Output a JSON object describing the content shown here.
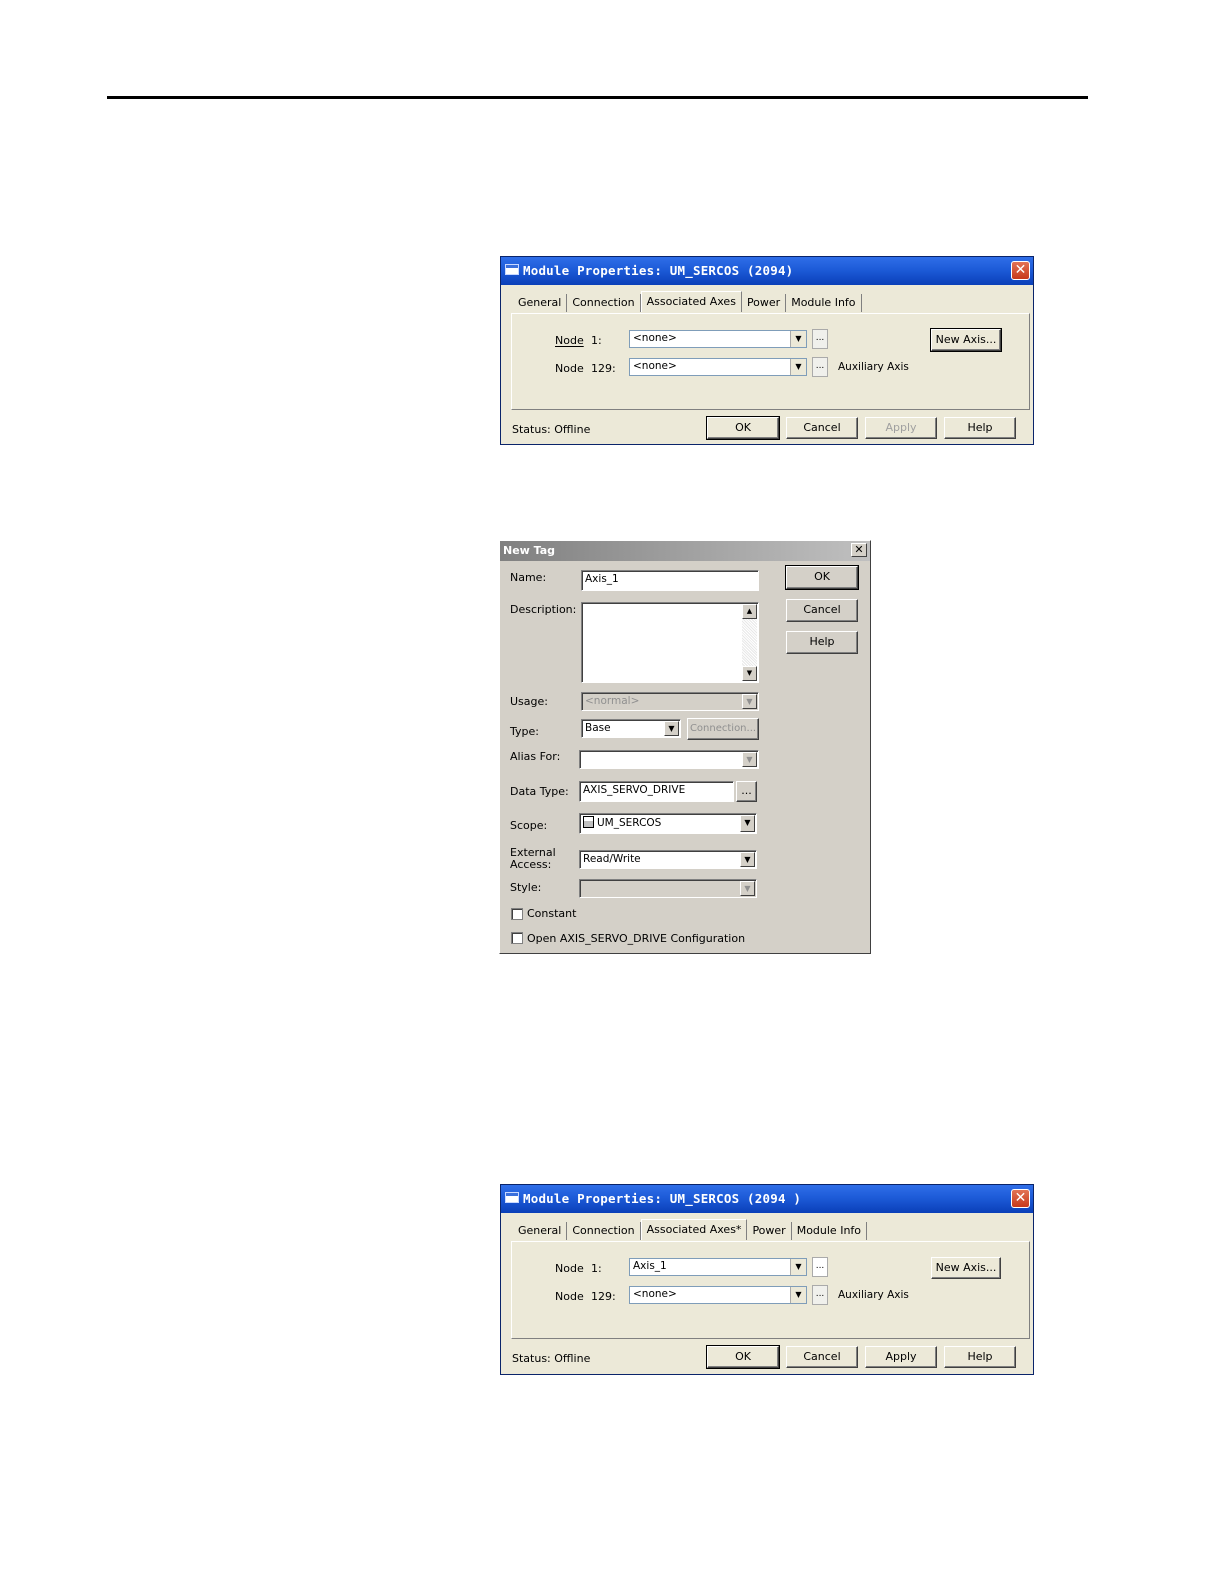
{
  "module_dialog_1": {
    "title": "Module Properties: UM_SERCOS (2094)",
    "tabs": [
      "General",
      "Connection",
      "Associated Axes",
      "Power",
      "Module Info"
    ],
    "node1_label": "Node",
    "node1_num": "1:",
    "node1_value": "<none>",
    "node129_label": "Node",
    "node129_num": "129:",
    "node129_value": "<none>",
    "auxiliary_label": "Auxiliary Axis",
    "new_axis_button": "New Axis...",
    "status": "Status:  Offline",
    "buttons": {
      "ok": "OK",
      "cancel": "Cancel",
      "apply": "Apply",
      "help": "Help"
    },
    "apply_enabled": false
  },
  "new_tag_dialog": {
    "title": "New Tag",
    "name_label": "Name:",
    "name_value": "Axis_1",
    "description_label": "Description:",
    "usage_label": "Usage:",
    "usage_value": "<normal>",
    "type_label": "Type:",
    "type_value": "Base",
    "connection_button": "Connection...",
    "alias_label": "Alias For:",
    "data_type_label": "Data Type:",
    "data_type_value": "AXIS_SERVO_DRIVE",
    "scope_label": "Scope:",
    "scope_value": "UM_SERCOS",
    "external_access_label_1": "External",
    "external_access_label_2": "Access:",
    "external_access_value": "Read/Write",
    "style_label": "Style:",
    "constant_label": "Constant",
    "open_config_label": "Open AXIS_SERVO_DRIVE Configuration",
    "buttons": {
      "ok": "OK",
      "cancel": "Cancel",
      "help": "Help"
    }
  },
  "module_dialog_2": {
    "title": "Module Properties: UM_SERCOS (2094 )",
    "tabs": [
      "General",
      "Connection",
      "Associated Axes*",
      "Power",
      "Module Info"
    ],
    "node1_label": "Node",
    "node1_num": "1:",
    "node1_value": "Axis_1",
    "node129_label": "Node",
    "node129_num": "129:",
    "node129_value": "<none>",
    "auxiliary_label": "Auxiliary Axis",
    "new_axis_button": "New Axis...",
    "status": "Status:  Offline",
    "buttons": {
      "ok": "OK",
      "cancel": "Cancel",
      "apply": "Apply",
      "help": "Help"
    },
    "apply_enabled": true
  }
}
